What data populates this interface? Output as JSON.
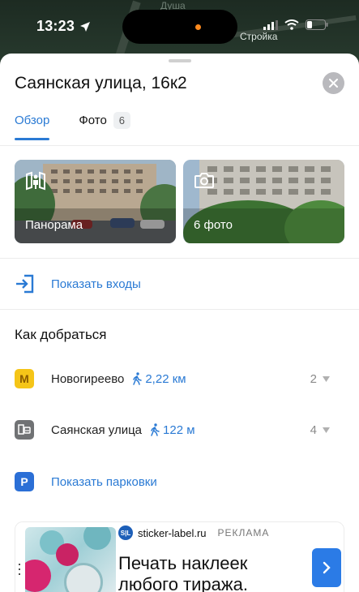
{
  "status_bar": {
    "time": "13:23",
    "map_label_1": "Душа",
    "map_label_2": "Стройка"
  },
  "place": {
    "title": "Саянская улица, 16к2"
  },
  "tabs": [
    {
      "label": "Обзор",
      "active": true
    },
    {
      "label": "Фото",
      "badge": "6",
      "active": false
    }
  ],
  "photos": {
    "panorama_label": "Панорама",
    "photos_label": "6 фото"
  },
  "entrances": {
    "label": "Показать входы"
  },
  "how_to_get": {
    "title": "Как добраться",
    "routes": [
      {
        "icon": "metro-icon",
        "icon_letter": "М",
        "name": "Новогиреево",
        "distance": "2,22 км",
        "count": "2"
      },
      {
        "icon": "bus-stop-icon",
        "name": "Саянская улица",
        "distance": "122 м",
        "count": "4"
      }
    ],
    "parking_label": "Показать парковки",
    "parking_letter": "P"
  },
  "ad": {
    "logo_text": "S|L",
    "domain": "sticker-label.ru",
    "tag": "РЕКЛАМА",
    "headline": "Печать наклеек любого тиража."
  },
  "colors": {
    "accent": "#2a7ad4",
    "metro_badge": "#f5c518",
    "parking_badge": "#2b6fd6"
  }
}
